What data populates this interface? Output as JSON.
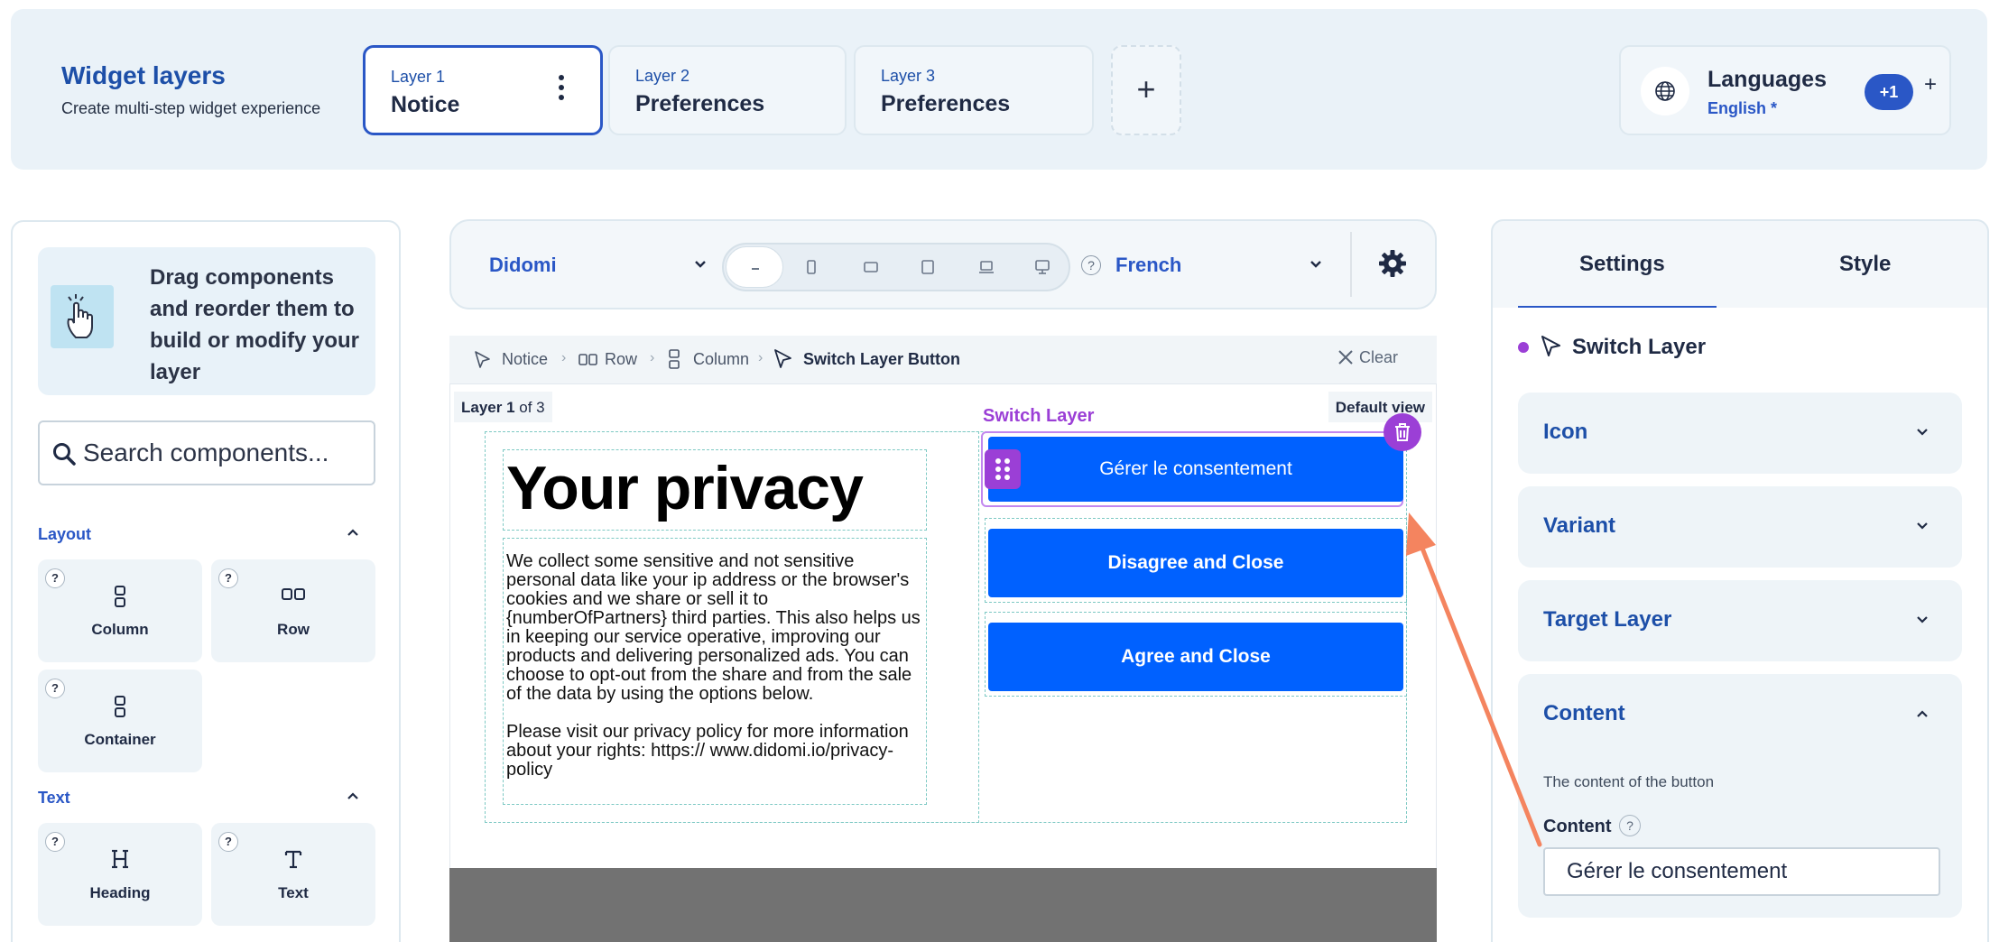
{
  "header": {
    "title": "Widget layers",
    "subtitle": "Create multi-step widget experience",
    "layers": [
      {
        "number": "Layer 1",
        "name": "Notice"
      },
      {
        "number": "Layer 2",
        "name": "Preferences"
      },
      {
        "number": "Layer 3",
        "name": "Preferences"
      }
    ],
    "add_layer": "+",
    "languages": {
      "title": "Languages",
      "current": "English *",
      "badge": "+1",
      "add": "+"
    }
  },
  "left_panel": {
    "hint": "Drag components and reorder them to build or modify your layer",
    "search_placeholder": "Search components...",
    "sections": [
      {
        "title": "Layout",
        "items": [
          "Column",
          "Row",
          "Container"
        ]
      },
      {
        "title": "Text",
        "items": [
          "Heading",
          "Text"
        ]
      }
    ],
    "help": "?"
  },
  "toolbar": {
    "organization": "Didomi",
    "language": "French",
    "help": "?"
  },
  "breadcrumb": {
    "items": [
      "Notice",
      "Row",
      "Column",
      "Switch Layer Button"
    ],
    "clear": "Clear"
  },
  "canvas": {
    "layer_indicator_bold": "Layer 1",
    "layer_indicator_rest": " of 3",
    "default_view": "Default view",
    "selected_label": "Switch Layer",
    "notice_title": "Your privacy",
    "notice_paragraph_1": "We collect some sensitive and not sensitive personal data like your ip address or the browser's cookies and we share or sell it to {numberOfPartners} third parties. This also helps us in keeping our service operative, improving our products and delivering personalized ads. You can choose to opt-out from the share and from the sale of the data by using the options below.",
    "notice_paragraph_2": "Please visit our privacy policy for more information about your rights: https:// www.didomi.io/privacy-policy",
    "buttons": [
      "Gérer le consentement",
      "Disagree and Close",
      "Agree and Close"
    ]
  },
  "right_panel": {
    "tabs": [
      "Settings",
      "Style"
    ],
    "selected_component": "Switch Layer",
    "accordions": [
      "Icon",
      "Variant",
      "Target Layer",
      "Content"
    ],
    "content_description": "The content of the button",
    "content_field_label": "Content",
    "content_field_help": "?",
    "content_value": "Gérer le consentement"
  },
  "colors": {
    "accent": "#2a57c6",
    "button_blue": "#0061ff",
    "selection_purple": "#9b3fd6",
    "annotation_arrow": "#f4845f"
  }
}
